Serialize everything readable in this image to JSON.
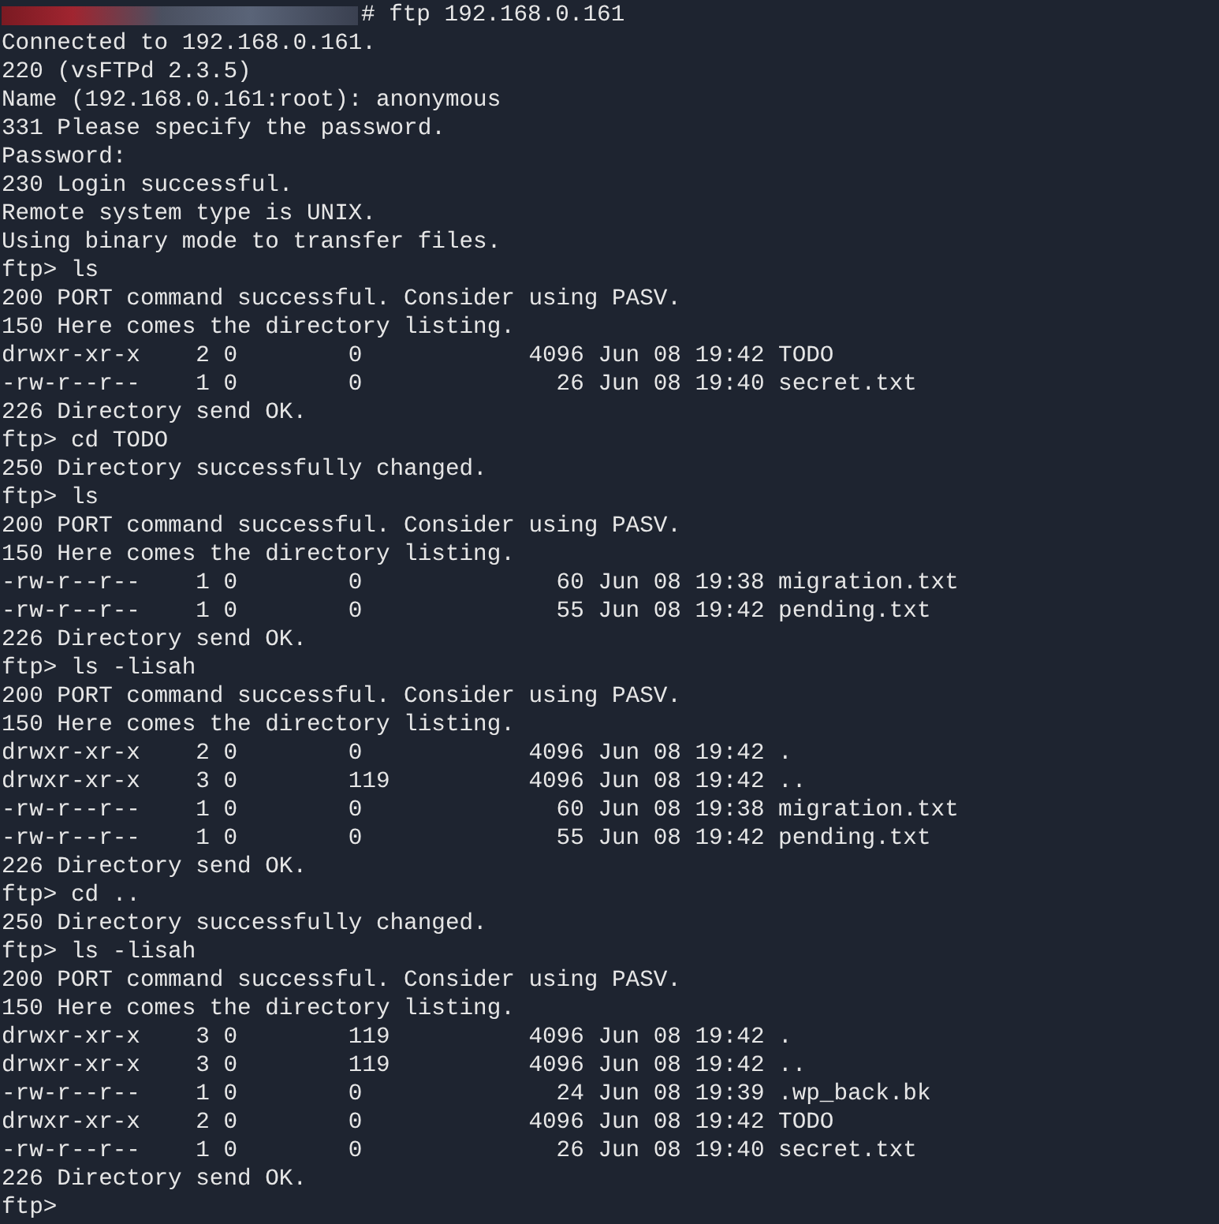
{
  "terminal": {
    "first_line": {
      "redacted_prompt": true,
      "command": "# ftp 192.168.0.161"
    },
    "lines": [
      "Connected to 192.168.0.161.",
      "220 (vsFTPd 2.3.5)",
      "Name (192.168.0.161:root): anonymous",
      "331 Please specify the password.",
      "Password:",
      "230 Login successful.",
      "Remote system type is UNIX.",
      "Using binary mode to transfer files.",
      "ftp> ls",
      "200 PORT command successful. Consider using PASV.",
      "150 Here comes the directory listing.",
      "drwxr-xr-x    2 0        0            4096 Jun 08 19:42 TODO",
      "-rw-r--r--    1 0        0              26 Jun 08 19:40 secret.txt",
      "226 Directory send OK.",
      "ftp> cd TODO",
      "250 Directory successfully changed.",
      "ftp> ls",
      "200 PORT command successful. Consider using PASV.",
      "150 Here comes the directory listing.",
      "-rw-r--r--    1 0        0              60 Jun 08 19:38 migration.txt",
      "-rw-r--r--    1 0        0              55 Jun 08 19:42 pending.txt",
      "226 Directory send OK.",
      "ftp> ls -lisah",
      "200 PORT command successful. Consider using PASV.",
      "150 Here comes the directory listing.",
      "drwxr-xr-x    2 0        0            4096 Jun 08 19:42 .",
      "drwxr-xr-x    3 0        119          4096 Jun 08 19:42 ..",
      "-rw-r--r--    1 0        0              60 Jun 08 19:38 migration.txt",
      "-rw-r--r--    1 0        0              55 Jun 08 19:42 pending.txt",
      "226 Directory send OK.",
      "ftp> cd ..",
      "250 Directory successfully changed.",
      "ftp> ls -lisah",
      "200 PORT command successful. Consider using PASV.",
      "150 Here comes the directory listing.",
      "drwxr-xr-x    3 0        119          4096 Jun 08 19:42 .",
      "drwxr-xr-x    3 0        119          4096 Jun 08 19:42 ..",
      "-rw-r--r--    1 0        0              24 Jun 08 19:39 .wp_back.bk",
      "drwxr-xr-x    2 0        0            4096 Jun 08 19:42 TODO",
      "-rw-r--r--    1 0        0              26 Jun 08 19:40 secret.txt",
      "226 Directory send OK.",
      "ftp>"
    ]
  }
}
